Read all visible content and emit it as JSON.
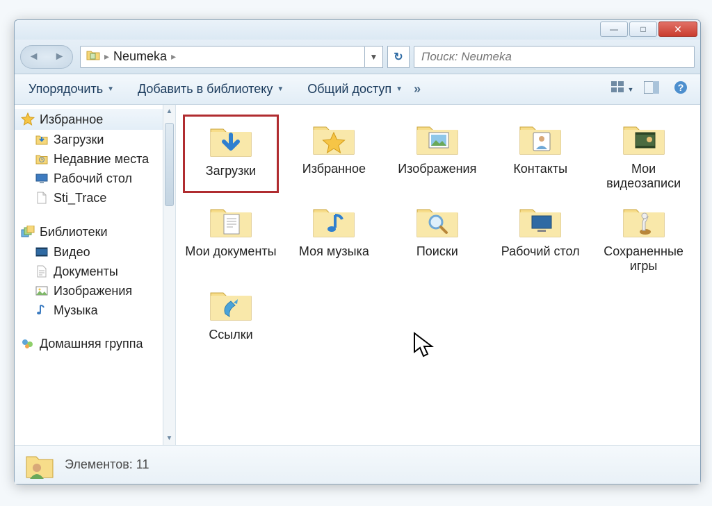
{
  "breadcrumb": {
    "current": "Neumeka"
  },
  "search": {
    "placeholder": "Поиск: Neumeka"
  },
  "toolbar": {
    "organize": "Упорядочить",
    "addlib": "Добавить в библиотеку",
    "share": "Общий доступ",
    "more": "»"
  },
  "sidebar": {
    "favorites_title": "Избранное",
    "favorites": [
      {
        "label": "Загрузки"
      },
      {
        "label": "Недавние места"
      },
      {
        "label": "Рабочий стол"
      },
      {
        "label": "Sti_Trace"
      }
    ],
    "libraries_title": "Библиотеки",
    "libraries": [
      {
        "label": "Видео"
      },
      {
        "label": "Документы"
      },
      {
        "label": "Изображения"
      },
      {
        "label": "Музыка"
      }
    ],
    "homegroup_title": "Домашняя группа"
  },
  "items": [
    {
      "label": "Загрузки"
    },
    {
      "label": "Избранное"
    },
    {
      "label": "Изображения"
    },
    {
      "label": "Контакты"
    },
    {
      "label": "Мои видеозаписи"
    },
    {
      "label": "Мои документы"
    },
    {
      "label": "Моя музыка"
    },
    {
      "label": "Поиски"
    },
    {
      "label": "Рабочий стол"
    },
    {
      "label": "Сохраненные игры"
    },
    {
      "label": "Ссылки"
    }
  ],
  "status": {
    "text": "Элементов: 11"
  }
}
